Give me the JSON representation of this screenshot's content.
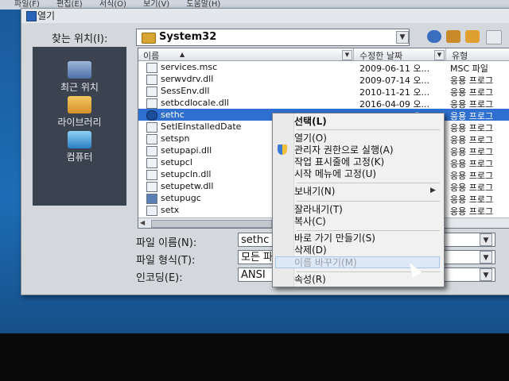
{
  "menubar": {
    "items": [
      "파일(F)",
      "편집(E)",
      "서식(O)",
      "보기(V)",
      "도움말(H)"
    ]
  },
  "dialog": {
    "title": "열기",
    "look_in_label": "찾는 위치(I):",
    "look_in_value": "System32"
  },
  "places": [
    {
      "label": "최근 위치",
      "icon": "recent-places-icon"
    },
    {
      "label": "라이브러리",
      "icon": "libraries-icon"
    },
    {
      "label": "컴퓨터",
      "icon": "computer-icon"
    }
  ],
  "columns": {
    "name": "이름",
    "date": "수정한 날짜",
    "type": "유형"
  },
  "files": [
    {
      "name": "services.msc",
      "date": "2009-06-11 오...",
      "type": "MSC 파일"
    },
    {
      "name": "serwvdrv.dll",
      "date": "2009-07-14 오...",
      "type": "응용 프로그"
    },
    {
      "name": "SessEnv.dll",
      "date": "2010-11-21 오...",
      "type": "응용 프로그"
    },
    {
      "name": "setbcdlocale.dll",
      "date": "2016-04-09 오...",
      "type": "응용 프로그"
    },
    {
      "name": "sethc",
      "date": "2010-11-21 오...",
      "type": "응용 프로그"
    },
    {
      "name": "SetIEInstalledDate",
      "date": "",
      "type": "응용 프로그"
    },
    {
      "name": "setspn",
      "date": "",
      "type": "응용 프로그"
    },
    {
      "name": "setupapi.dll",
      "date": "",
      "type": "응용 프로그"
    },
    {
      "name": "setupcl",
      "date": "",
      "type": "응용 프로그"
    },
    {
      "name": "setupcln.dll",
      "date": "",
      "type": "응용 프로그"
    },
    {
      "name": "setupetw.dll",
      "date": "",
      "type": "응용 프로그"
    },
    {
      "name": "setupugc",
      "date": "",
      "type": "응용 프로그"
    },
    {
      "name": "setx",
      "date": "",
      "type": "응용 프로그"
    }
  ],
  "fields": {
    "filename_label": "파일 이름(N):",
    "filename_value": "sethc",
    "filetype_label": "파일 형식(T):",
    "filetype_value": "모든 파",
    "encoding_label": "인코딩(E):",
    "encoding_value": "ANSI"
  },
  "context_menu": [
    {
      "label": "선택(L)",
      "style": "bold"
    },
    {
      "sep": true
    },
    {
      "label": "열기(O)"
    },
    {
      "label": "관리자 권한으로 실행(A)",
      "icon": "uac-shield-icon"
    },
    {
      "label": "작업 표시줄에 고정(K)"
    },
    {
      "label": "시작 메뉴에 고정(U)"
    },
    {
      "sep": true
    },
    {
      "label": "보내기(N)",
      "submenu": true
    },
    {
      "sep": true
    },
    {
      "label": "잘라내기(T)"
    },
    {
      "label": "복사(C)"
    },
    {
      "sep": true
    },
    {
      "label": "바로 가기 만들기(S)"
    },
    {
      "label": "삭제(D)"
    },
    {
      "label": "이름 바꾸기(M)",
      "style": "highlighted-disabled"
    },
    {
      "sep": true
    },
    {
      "label": "속성(R)"
    }
  ],
  "colors": {
    "selection": "#2f6fd0",
    "places_bg": "#3c4350",
    "menu_hover": "#dde9f7"
  }
}
